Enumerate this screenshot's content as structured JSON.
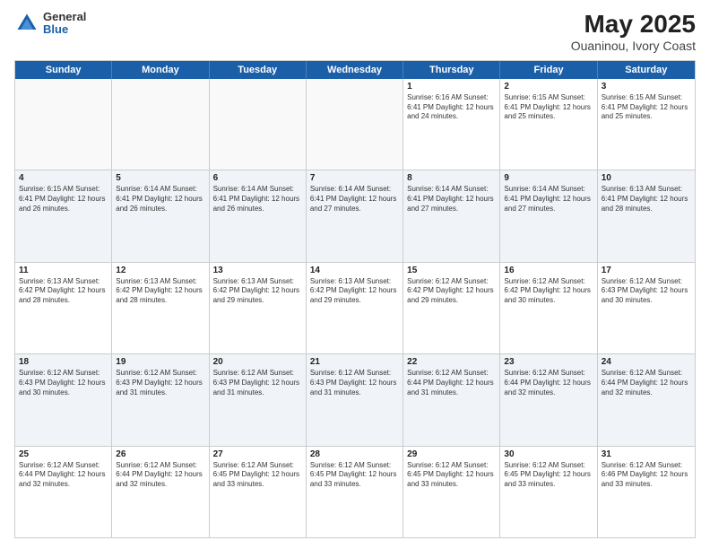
{
  "header": {
    "logo_line1": "General",
    "logo_line2": "Blue",
    "title": "May 2025",
    "subtitle": "Ouaninou, Ivory Coast"
  },
  "days_of_week": [
    "Sunday",
    "Monday",
    "Tuesday",
    "Wednesday",
    "Thursday",
    "Friday",
    "Saturday"
  ],
  "weeks": [
    [
      {
        "day": "",
        "info": ""
      },
      {
        "day": "",
        "info": ""
      },
      {
        "day": "",
        "info": ""
      },
      {
        "day": "",
        "info": ""
      },
      {
        "day": "1",
        "info": "Sunrise: 6:16 AM\nSunset: 6:41 PM\nDaylight: 12 hours and 24 minutes."
      },
      {
        "day": "2",
        "info": "Sunrise: 6:15 AM\nSunset: 6:41 PM\nDaylight: 12 hours and 25 minutes."
      },
      {
        "day": "3",
        "info": "Sunrise: 6:15 AM\nSunset: 6:41 PM\nDaylight: 12 hours and 25 minutes."
      }
    ],
    [
      {
        "day": "4",
        "info": "Sunrise: 6:15 AM\nSunset: 6:41 PM\nDaylight: 12 hours and 26 minutes."
      },
      {
        "day": "5",
        "info": "Sunrise: 6:14 AM\nSunset: 6:41 PM\nDaylight: 12 hours and 26 minutes."
      },
      {
        "day": "6",
        "info": "Sunrise: 6:14 AM\nSunset: 6:41 PM\nDaylight: 12 hours and 26 minutes."
      },
      {
        "day": "7",
        "info": "Sunrise: 6:14 AM\nSunset: 6:41 PM\nDaylight: 12 hours and 27 minutes."
      },
      {
        "day": "8",
        "info": "Sunrise: 6:14 AM\nSunset: 6:41 PM\nDaylight: 12 hours and 27 minutes."
      },
      {
        "day": "9",
        "info": "Sunrise: 6:14 AM\nSunset: 6:41 PM\nDaylight: 12 hours and 27 minutes."
      },
      {
        "day": "10",
        "info": "Sunrise: 6:13 AM\nSunset: 6:41 PM\nDaylight: 12 hours and 28 minutes."
      }
    ],
    [
      {
        "day": "11",
        "info": "Sunrise: 6:13 AM\nSunset: 6:42 PM\nDaylight: 12 hours and 28 minutes."
      },
      {
        "day": "12",
        "info": "Sunrise: 6:13 AM\nSunset: 6:42 PM\nDaylight: 12 hours and 28 minutes."
      },
      {
        "day": "13",
        "info": "Sunrise: 6:13 AM\nSunset: 6:42 PM\nDaylight: 12 hours and 29 minutes."
      },
      {
        "day": "14",
        "info": "Sunrise: 6:13 AM\nSunset: 6:42 PM\nDaylight: 12 hours and 29 minutes."
      },
      {
        "day": "15",
        "info": "Sunrise: 6:12 AM\nSunset: 6:42 PM\nDaylight: 12 hours and 29 minutes."
      },
      {
        "day": "16",
        "info": "Sunrise: 6:12 AM\nSunset: 6:42 PM\nDaylight: 12 hours and 30 minutes."
      },
      {
        "day": "17",
        "info": "Sunrise: 6:12 AM\nSunset: 6:43 PM\nDaylight: 12 hours and 30 minutes."
      }
    ],
    [
      {
        "day": "18",
        "info": "Sunrise: 6:12 AM\nSunset: 6:43 PM\nDaylight: 12 hours and 30 minutes."
      },
      {
        "day": "19",
        "info": "Sunrise: 6:12 AM\nSunset: 6:43 PM\nDaylight: 12 hours and 31 minutes."
      },
      {
        "day": "20",
        "info": "Sunrise: 6:12 AM\nSunset: 6:43 PM\nDaylight: 12 hours and 31 minutes."
      },
      {
        "day": "21",
        "info": "Sunrise: 6:12 AM\nSunset: 6:43 PM\nDaylight: 12 hours and 31 minutes."
      },
      {
        "day": "22",
        "info": "Sunrise: 6:12 AM\nSunset: 6:44 PM\nDaylight: 12 hours and 31 minutes."
      },
      {
        "day": "23",
        "info": "Sunrise: 6:12 AM\nSunset: 6:44 PM\nDaylight: 12 hours and 32 minutes."
      },
      {
        "day": "24",
        "info": "Sunrise: 6:12 AM\nSunset: 6:44 PM\nDaylight: 12 hours and 32 minutes."
      }
    ],
    [
      {
        "day": "25",
        "info": "Sunrise: 6:12 AM\nSunset: 6:44 PM\nDaylight: 12 hours and 32 minutes."
      },
      {
        "day": "26",
        "info": "Sunrise: 6:12 AM\nSunset: 6:44 PM\nDaylight: 12 hours and 32 minutes."
      },
      {
        "day": "27",
        "info": "Sunrise: 6:12 AM\nSunset: 6:45 PM\nDaylight: 12 hours and 33 minutes."
      },
      {
        "day": "28",
        "info": "Sunrise: 6:12 AM\nSunset: 6:45 PM\nDaylight: 12 hours and 33 minutes."
      },
      {
        "day": "29",
        "info": "Sunrise: 6:12 AM\nSunset: 6:45 PM\nDaylight: 12 hours and 33 minutes."
      },
      {
        "day": "30",
        "info": "Sunrise: 6:12 AM\nSunset: 6:45 PM\nDaylight: 12 hours and 33 minutes."
      },
      {
        "day": "31",
        "info": "Sunrise: 6:12 AM\nSunset: 6:46 PM\nDaylight: 12 hours and 33 minutes."
      }
    ]
  ]
}
